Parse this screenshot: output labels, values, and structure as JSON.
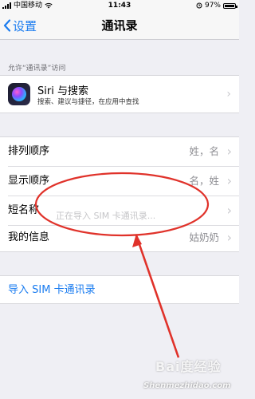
{
  "status_bar": {
    "carrier": "中国移动",
    "time": "11:43",
    "battery": "97%",
    "battery_level": 0.97
  },
  "nav": {
    "back_label": "设置",
    "title": "通讯录"
  },
  "siri_section": {
    "header": "允许“通讯录”访问",
    "title": "Siri 与搜索",
    "subtitle": "搜索、建议与捷径，在应用中查找"
  },
  "settings": [
    {
      "label": "排列顺序",
      "value": "姓，名"
    },
    {
      "label": "显示顺序",
      "value": "名，姓"
    },
    {
      "label": "短名称",
      "value": ""
    },
    {
      "label": "我的信息",
      "value": "姑奶奶"
    }
  ],
  "loading_text": "正在导入 SIM 卡通讯录...",
  "import_label": "导入 SIM 卡通讯录",
  "watermark": {
    "logo": "Bai度经验",
    "url": "Shenmezhidao.com"
  },
  "colors": {
    "accent": "#1a7cf0",
    "annotation": "#e0322a"
  },
  "icons": {
    "back": "chevron-left-icon",
    "row": "chevron-right-icon",
    "siri": "siri-icon",
    "wifi": "wifi-icon",
    "battery": "battery-icon",
    "signal": "signal-icon"
  }
}
